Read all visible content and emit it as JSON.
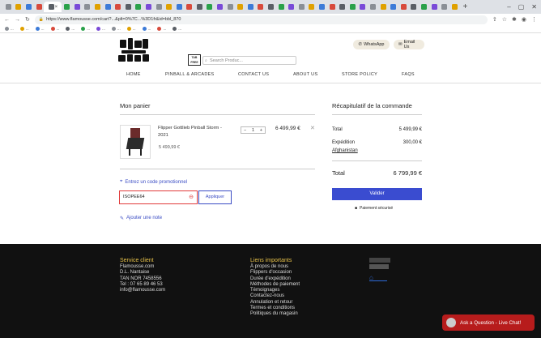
{
  "browser": {
    "url": "https://www.flamousse.com/cart?...&plt=0%7C...%3D1fr&id=bbl_870",
    "tabs_count": 44,
    "bookmarks": [
      "...",
      "...",
      "...",
      "...",
      "...",
      "...",
      "...",
      "...",
      "...",
      "...",
      "...",
      "..."
    ]
  },
  "header": {
    "search_placeholder": "Search Produc...",
    "cart_logo_text": "TAB FREE",
    "whatsapp_label": "WhatsApp",
    "email_label": "Email Us"
  },
  "nav": [
    "HOME",
    "PINBALL & ARCADES",
    "CONTACT US",
    "ABOUT US",
    "STORE POLICY",
    "FAQS"
  ],
  "cart": {
    "title": "Mon panier",
    "item": {
      "name": "Flipper Gottlieb Pinball Storm - 2021",
      "unit_price": "5 499,99 €",
      "qty": "1",
      "line_total": "6 499,99 €"
    },
    "promo_link": "Entrez un code promotionnel",
    "promo_value": "ISOPEE64",
    "apply_label": "Appliquer",
    "note_link": "Ajouter une note"
  },
  "summary": {
    "title": "Récapitulatif de la commande",
    "total_label": "Total",
    "total_value": "5 499,99 €",
    "shipping_label": "Expédition",
    "shipping_value": "300,00 €",
    "region_link": "Afghanistan",
    "grand_label": "Total",
    "grand_value": "6 799,99 €",
    "checkout_label": "Valider",
    "secure_label": "Paiement sécurisé"
  },
  "footer": {
    "service_title": "Service client",
    "service_lines": [
      "Flamousse.com",
      "D.L. Nantaise",
      "TAN NOR 7458556",
      "Tel : 07 65 89 46 53",
      "info@flamousse.com"
    ],
    "links_title": "Liens importants",
    "links": [
      "À propos de nous",
      "Flippers d'occasion",
      "Durée d'expédition",
      "Méthodes de paiement",
      "Témoignages",
      "Contactez-nous",
      "Annulation et retour",
      "Termes et conditions",
      "Politiques du magasin"
    ]
  },
  "chat": {
    "label": "Ask a Question - Live Chat!"
  }
}
